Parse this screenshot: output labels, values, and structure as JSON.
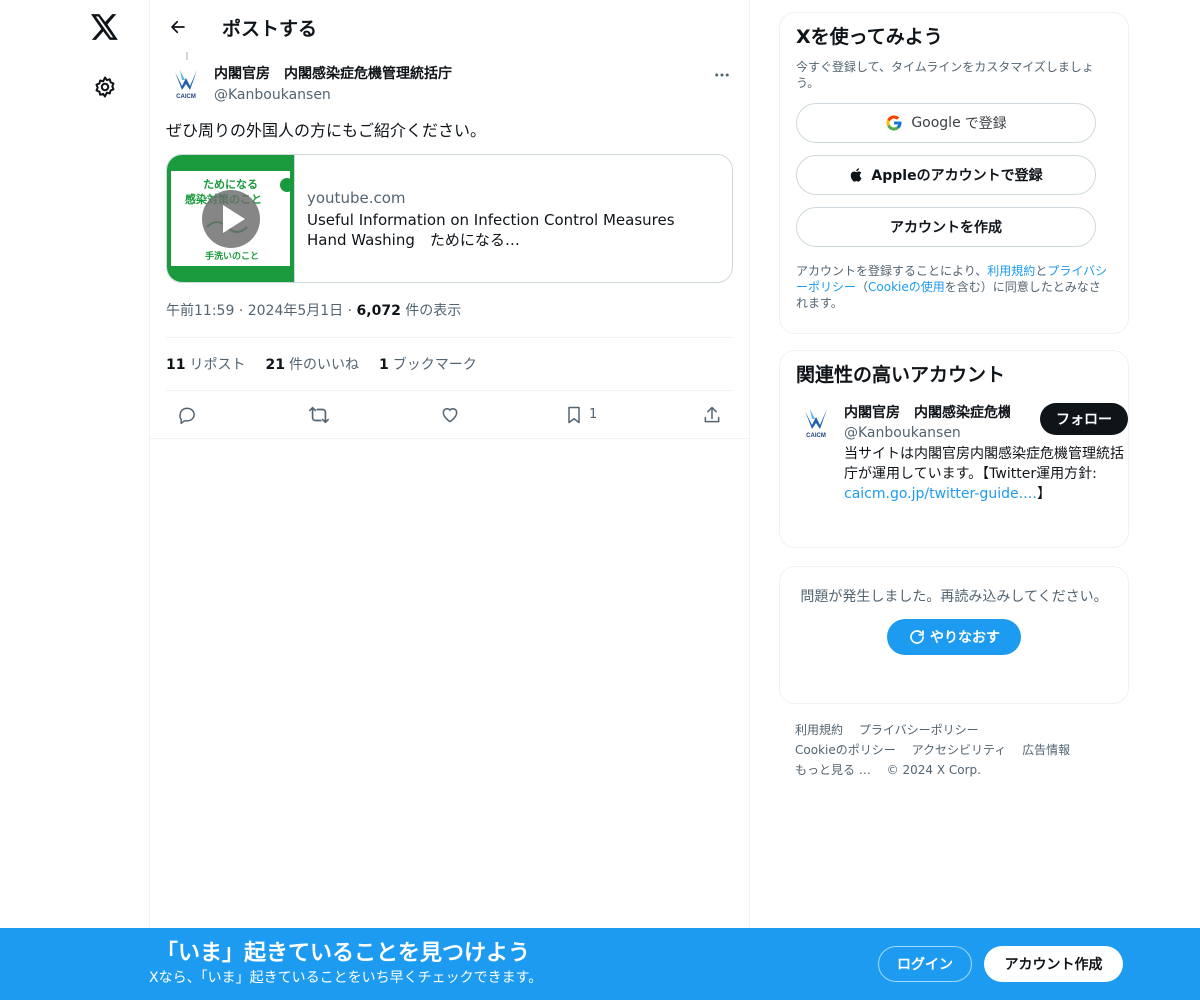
{
  "header": {
    "title": "ポストする"
  },
  "tweet": {
    "author_name": "内閣官房　内閣感染症危機管理統括庁",
    "author_handle": "@Kanboukansen",
    "text": "ぜひ周りの外国人の方にもご紹介ください。",
    "card": {
      "domain": "youtube.com",
      "title": "Useful Information on Infection Control Measures　Hand Washing　ためになる…",
      "thumb_lines": [
        "ためになる",
        "感染対策のこと",
        "手洗いのこと"
      ]
    },
    "meta": {
      "time": "午前11:59",
      "date": "2024年5月1日",
      "views_count": "6,072",
      "views_label": "件の表示",
      "dot": "·"
    },
    "stats": {
      "reposts_count": "11",
      "reposts_label": "リポスト",
      "likes_count": "21",
      "likes_label": "件のいいね",
      "bookmarks_count": "1",
      "bookmarks_label": "ブックマーク"
    },
    "actions": {
      "bookmark_count": "1"
    }
  },
  "avatar_label": "CAICM",
  "signup": {
    "title": "Xを使ってみよう",
    "subtitle": "今すぐ登録して、タイムラインをカスタマイズしましょう。",
    "google_label": "Google",
    "google_suffix": "で登録",
    "apple_label": "Appleのアカウントで登録",
    "create_label": "アカウントを作成",
    "legal_prefix": "アカウントを登録することにより、",
    "legal_terms": "利用規約",
    "legal_and": "と",
    "legal_privacy": "プライバシーポリシー",
    "legal_mid": "（",
    "legal_cookie": "Cookieの使用",
    "legal_suffix": "を含む）に同意したとみなされます。"
  },
  "related": {
    "title": "関連性の高いアカウント",
    "name": "内閣官房　内閣感染症危機管理統括庁",
    "handle": "@Kanboukansen",
    "follow_label": "フォロー",
    "bio": "当サイトは内閣官房内閣感染症危機管理統括庁が運用しています。【Twitter運用方針: ",
    "bio_link": "caicm.go.jp/twitter-guide.…",
    "bio_end": "】"
  },
  "error": {
    "message": "問題が発生しました。再読み込みしてください。",
    "retry_label": "やりなおす"
  },
  "footer": {
    "links": [
      "利用規約",
      "プライバシーポリシー",
      "Cookieのポリシー",
      "アクセシビリティ",
      "広告情報",
      "もっと見る …",
      "© 2024 X Corp."
    ]
  },
  "banner": {
    "title": "「いま」起きていることを見つけよう",
    "subtitle": "Xなら、「いま」起きていることをいち早くチェックできます。",
    "login_label": "ログイン",
    "create_label": "アカウント作成"
  },
  "colors": {
    "accent": "#1d9bf0",
    "text": "#0f1419",
    "muted": "#536471",
    "border": "#eff3f4",
    "thumb_green": "#1a9a3c"
  }
}
